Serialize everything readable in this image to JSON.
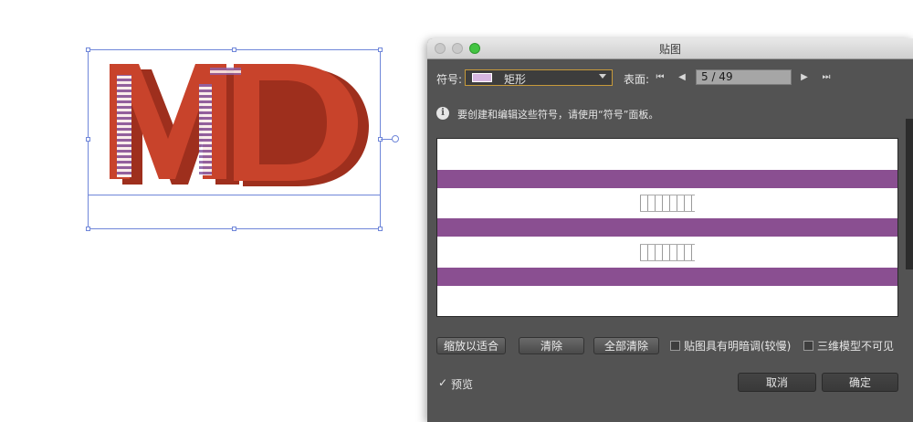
{
  "dialog": {
    "title": "贴图",
    "symbol_label": "符号:",
    "symbol_value": "矩形",
    "surface_label": "表面:",
    "surface_page": "5 / 49",
    "info_text": "要创建和编辑这些符号，请使用“符号”面板。",
    "buttons": {
      "fit": "缩放以适合",
      "clear": "清除",
      "clear_all": "全部清除",
      "cancel": "取消",
      "ok": "确定"
    },
    "checkboxes": {
      "shading": "贴图具有明暗调(较慢)",
      "invisible": "三维模型不可见",
      "preview": "预览"
    },
    "preview_checked_mark": "✓",
    "info_icon": "i"
  },
  "artwork": {
    "text": "MD",
    "color": "#c8432b"
  },
  "colors": {
    "stripe": "#8a4f91",
    "swatch": "#d7b6e0",
    "dialog_bg": "#535353",
    "selection": "#6f86d9"
  }
}
